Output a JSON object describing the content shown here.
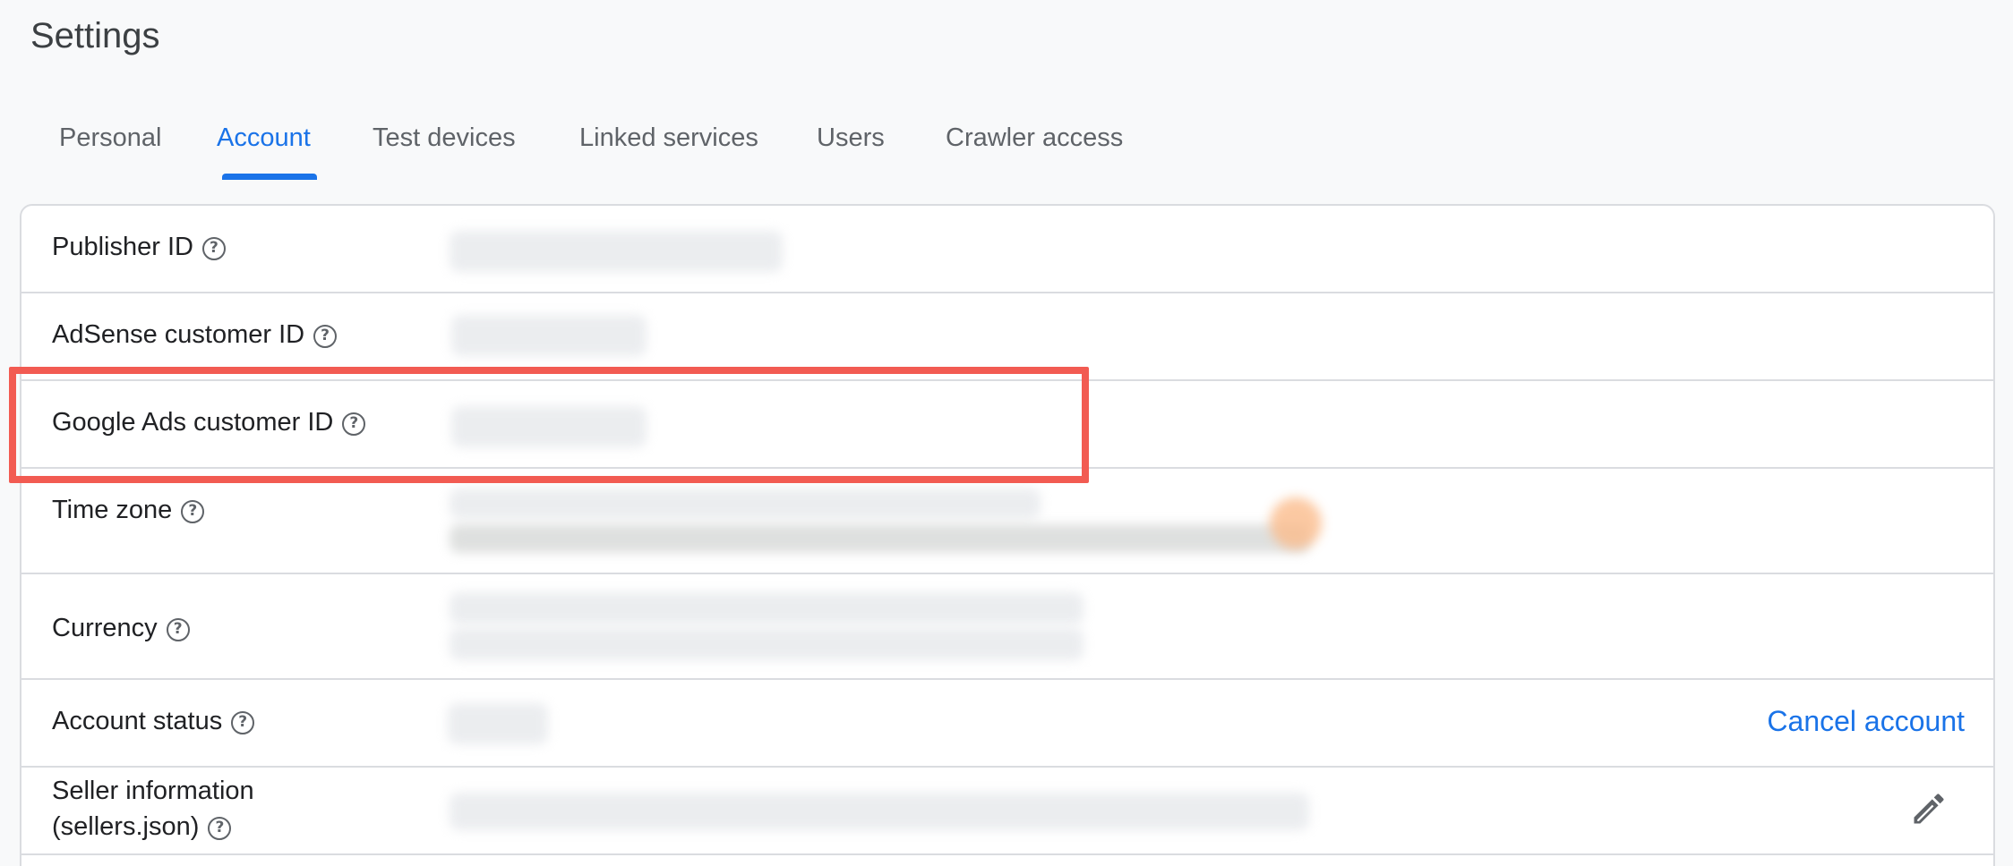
{
  "page": {
    "title": "Settings"
  },
  "tabs": [
    {
      "label": "Personal"
    },
    {
      "label": "Account"
    },
    {
      "label": "Test devices"
    },
    {
      "label": "Linked services"
    },
    {
      "label": "Users"
    },
    {
      "label": "Crawler access"
    }
  ],
  "active_tab": "Account",
  "rows": {
    "publisher_id": {
      "label": "Publisher ID"
    },
    "adsense_customer_id": {
      "label": "AdSense customer ID"
    },
    "google_ads_customer_id": {
      "label": "Google Ads customer ID"
    },
    "time_zone": {
      "label": "Time zone"
    },
    "currency": {
      "label": "Currency"
    },
    "account_status": {
      "label": "Account status",
      "action": "Cancel account"
    },
    "seller_information": {
      "label_line1": "Seller information",
      "label_line2": "(sellers.json)"
    }
  },
  "icons": {
    "help": "help-circle-icon",
    "edit": "pencil-icon"
  },
  "help_glyph": "?",
  "colors": {
    "accent": "#1a73e8",
    "highlight": "#f25b52",
    "border": "#dadce0",
    "background": "#f8f9fa"
  }
}
